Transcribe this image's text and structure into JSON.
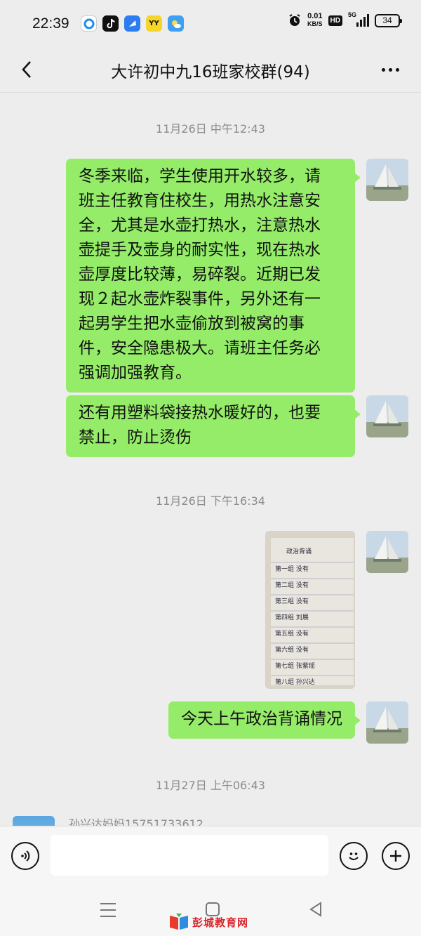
{
  "status_bar": {
    "time": "22:39",
    "net_speed_value": "0.01",
    "net_speed_unit": "KB/S",
    "hd_label": "HD",
    "network_type": "5G",
    "battery_level": "34",
    "app_icons": [
      "qq-browser-icon",
      "tiktok-icon",
      "feishu-icon",
      "yy-icon",
      "weather-icon"
    ]
  },
  "header": {
    "title": "大许初中九16班家校群(94)"
  },
  "chat": {
    "timestamps": [
      "11月26日 中午12:43",
      "11月26日 下午16:34",
      "11月27日 上午06:43"
    ],
    "messages": [
      {
        "lines": [
          "冬季来临，学生使用开水较多，请",
          "班主任教育住校生，用热水注意安",
          "全，尤其是水壶打热水，注意热水",
          "壶提手及壶身的耐实性，现在热水",
          "壶厚度比较薄，易碎裂。近期已发",
          "现２起水壶炸裂事件，另外还有一",
          "起男学生把水壶偷放到被窝的事",
          "件，安全隐患极大。请班主任务必",
          "强调加强教育。"
        ]
      },
      {
        "lines": [
          "还有用塑料袋接热水暖好的，也要",
          "禁止，防止烫伤"
        ]
      },
      {
        "photo": {
          "heading": "政治背诵",
          "rows": [
            "第一组 没有",
            "第二组 没有",
            "第三组 没有",
            "第四组 刘展",
            "第五组 没有",
            "第六组 没有",
            "第七组 张紫瑶",
            "第八组 孙兴达"
          ]
        }
      },
      {
        "lines": [
          "今天上午政治背诵情况"
        ]
      }
    ],
    "incoming_sender": "孙兴达妈妈15751733612"
  },
  "input_bar": {
    "placeholder": ""
  },
  "watermark": {
    "text": "彭城教育网"
  },
  "colors": {
    "bubble_green": "#95ec69",
    "background": "#ededed"
  }
}
